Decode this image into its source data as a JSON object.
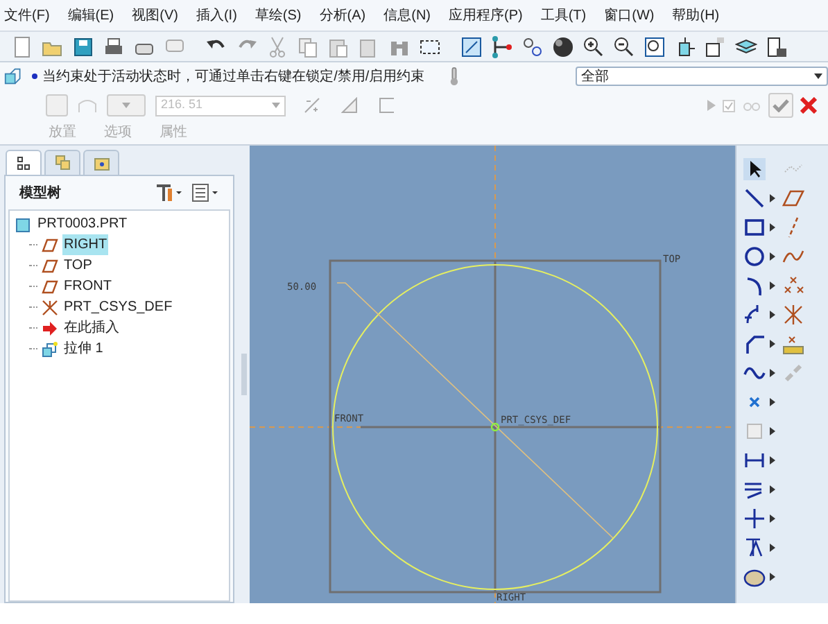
{
  "menu": [
    "文件(F)",
    "编辑(E)",
    "视图(V)",
    "插入(I)",
    "草绘(S)",
    "分析(A)",
    "信息(N)",
    "应用程序(P)",
    "工具(T)",
    "窗口(W)",
    "帮助(H)"
  ],
  "dashboard": {
    "message": "当约束处于活动状态时，可通过单击右键在锁定/禁用/启用约束",
    "filter": "全部",
    "value": "216. 51",
    "tabs": [
      "放置",
      "选项",
      "属性"
    ]
  },
  "model_tree": {
    "title": "模型树",
    "items": [
      {
        "label": "PRT0003.PRT",
        "kind": "part",
        "selected": false,
        "children": [
          {
            "label": "RIGHT",
            "kind": "plane",
            "selected": true
          },
          {
            "label": "TOP",
            "kind": "plane",
            "selected": false
          },
          {
            "label": "FRONT",
            "kind": "plane",
            "selected": false
          },
          {
            "label": "PRT_CSYS_DEF",
            "kind": "csys",
            "selected": false
          },
          {
            "label": "在此插入",
            "kind": "insert",
            "selected": false
          },
          {
            "label": "拉伸 1",
            "kind": "extrude",
            "selected": false
          }
        ]
      }
    ]
  },
  "sketch": {
    "dimension": "50.00",
    "top_label": "TOP",
    "front_label": "FRONT",
    "csys_label": "PRT_CSYS_DEF",
    "right_label": "RIGHT"
  }
}
